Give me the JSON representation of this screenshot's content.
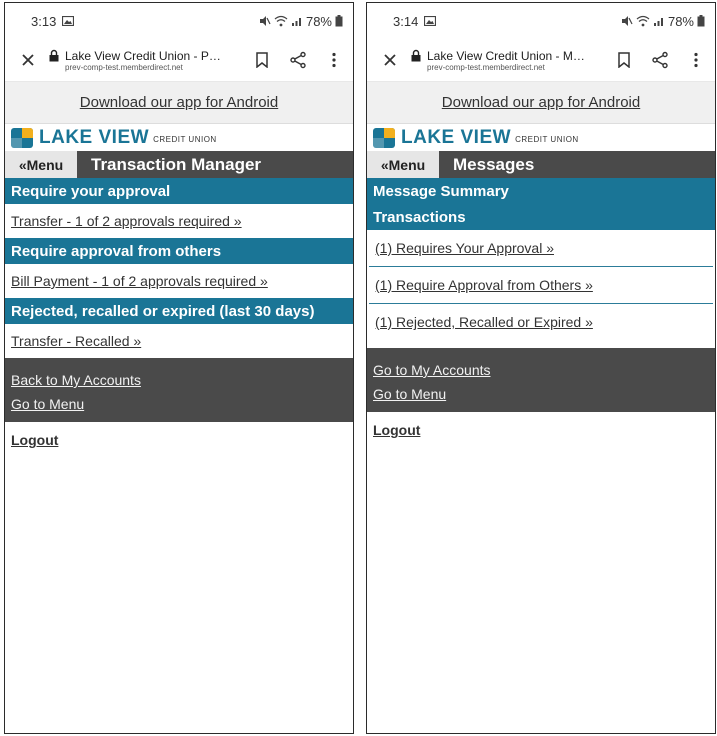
{
  "left": {
    "status": {
      "time": "3:13",
      "battery": "78%"
    },
    "browser": {
      "page_title": "Lake View Credit Union - Pe...",
      "url": "prev-comp-test.memberdirect.net"
    },
    "banner": {
      "download_label": "Download our app for Android"
    },
    "logo": {
      "name": "LAKE VIEW",
      "sub": "CREDIT UNION"
    },
    "header": {
      "menu_label": "«Menu",
      "title": "Transaction Manager"
    },
    "sections": [
      {
        "heading": "Require your approval",
        "link": "Transfer - 1 of 2 approvals required »"
      },
      {
        "heading": "Require approval from others",
        "link": "Bill Payment - 1 of 2 approvals required »"
      },
      {
        "heading": "Rejected, recalled or expired (last 30 days)",
        "link": "Transfer - Recalled »"
      }
    ],
    "footer": {
      "accounts_link": "Back to My Accounts",
      "menu_link": "Go to Menu"
    },
    "logout": "Logout"
  },
  "right": {
    "status": {
      "time": "3:14",
      "battery": "78%"
    },
    "browser": {
      "page_title": "Lake View Credit Union - Me...",
      "url": "prev-comp-test.memberdirect.net"
    },
    "banner": {
      "download_label": "Download our app for Android"
    },
    "logo": {
      "name": "LAKE VIEW",
      "sub": "CREDIT UNION"
    },
    "header": {
      "menu_label": "«Menu",
      "title": "Messages"
    },
    "summary": {
      "heading": "Message Summary",
      "subheading": "Transactions"
    },
    "items": [
      "(1) Requires Your Approval »",
      "(1) Require Approval from Others »",
      "(1) Rejected, Recalled or Expired »"
    ],
    "footer": {
      "accounts_link": "Go to My Accounts",
      "menu_link": "Go to Menu"
    },
    "logout": "Logout"
  },
  "colors": {
    "teal": "#1a7596",
    "dark_gray": "#4a4a4a",
    "banner_bg": "#f0f0f0",
    "logo_yellow": "#f2b01e"
  }
}
